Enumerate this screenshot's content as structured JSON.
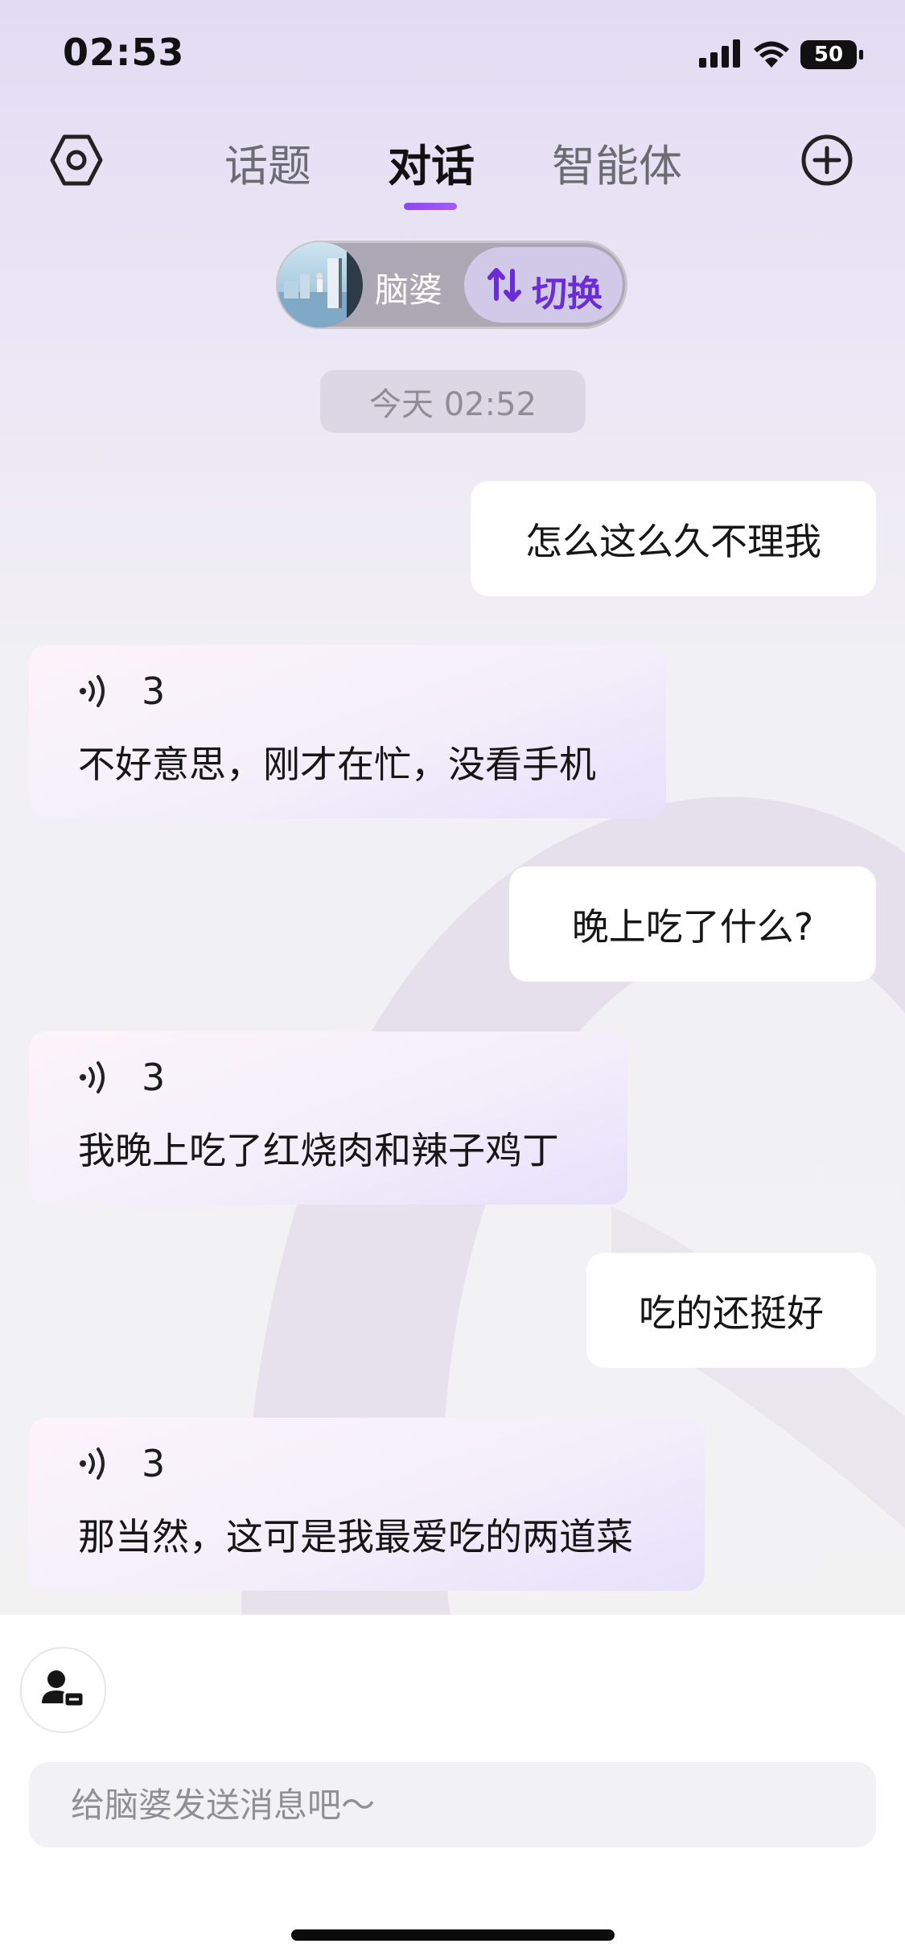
{
  "status_bar": {
    "time": "02:53",
    "battery": "50",
    "icons": [
      "cellular-signal-icon",
      "wifi-icon",
      "battery-icon"
    ]
  },
  "nav": {
    "settings_icon": "hexagon-settings-icon",
    "tabs": [
      {
        "label": "话题",
        "active": false
      },
      {
        "label": "对话",
        "active": true
      },
      {
        "label": "智能体",
        "active": false
      }
    ],
    "add_icon": "plus-circle-icon",
    "accent_color": "#8a49ef"
  },
  "agent": {
    "name": "脑婆",
    "switch_label": "切换",
    "switch_icon": "swap-arrows-icon"
  },
  "chat": {
    "timestamp": "今天 02:52",
    "messages": [
      {
        "role": "user",
        "text": "怎么这么久不理我"
      },
      {
        "role": "assistant",
        "audio_count": "3",
        "text": "不好意思，刚才在忙，没看手机"
      },
      {
        "role": "user",
        "text": "晚上吃了什么?"
      },
      {
        "role": "assistant",
        "audio_count": "3",
        "text": "我晚上吃了红烧肉和辣子鸡丁"
      },
      {
        "role": "user",
        "text": "吃的还挺好"
      },
      {
        "role": "assistant",
        "audio_count": "3",
        "text": "那当然，这可是我最爱吃的两道菜"
      }
    ]
  },
  "composer": {
    "voice_button_icon": "person-badge-icon",
    "placeholder": "给脑婆发送消息吧～"
  }
}
